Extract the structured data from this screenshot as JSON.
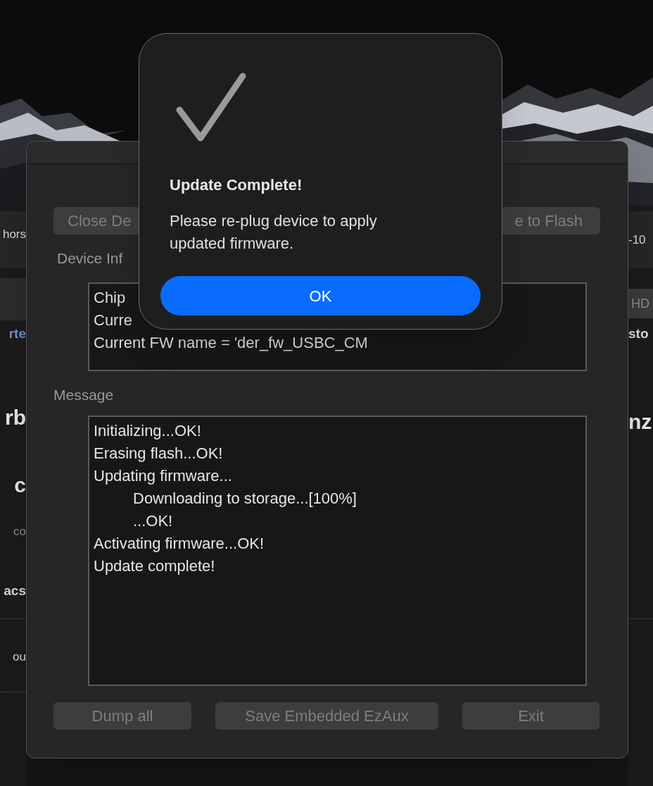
{
  "background_window": {
    "left_fragments": [
      {
        "text": "hors",
        "kind": "plain"
      },
      {
        "text": "rte",
        "kind": "link"
      },
      {
        "text": "rb",
        "kind": "heading"
      },
      {
        "text": "c",
        "kind": "heading"
      },
      {
        "text": "co",
        "kind": "muted"
      },
      {
        "text": "acs",
        "kind": "bold"
      },
      {
        "text": "ou",
        "kind": "plain"
      }
    ],
    "right_fragments": [
      {
        "text": "-10",
        "kind": "plain"
      },
      {
        "text": "HD",
        "kind": "button"
      },
      {
        "text": "sto",
        "kind": "bold"
      },
      {
        "text": "nz",
        "kind": "heading"
      }
    ]
  },
  "dialog": {
    "top_buttons": [
      {
        "label": "Close De",
        "disabled": true
      },
      {
        "label": "e to Flash",
        "disabled": true
      }
    ],
    "device_info": {
      "label": "Device Inf",
      "lines": [
        "Chip",
        "Curre",
        "Current FW name = 'der_fw_USBC_CM"
      ]
    },
    "message": {
      "label": "Message",
      "lines": [
        {
          "text": "Initializing...OK!",
          "indented": false
        },
        {
          "text": "Erasing flash...OK!",
          "indented": false
        },
        {
          "text": "Updating firmware...",
          "indented": false
        },
        {
          "text": "Downloading to storage...[100%]",
          "indented": true
        },
        {
          "text": "...OK!",
          "indented": true
        },
        {
          "text": "Activating firmware...OK!",
          "indented": false
        },
        {
          "text": "Update complete!",
          "indented": false
        }
      ]
    },
    "bottom_buttons": [
      {
        "label": "Dump all",
        "disabled": true
      },
      {
        "label": "Save Embedded EzAux",
        "disabled": true
      },
      {
        "label": "Exit",
        "disabled": true
      }
    ]
  },
  "alert": {
    "title": "Update Complete!",
    "message": "Please re-plug device to apply updated firmware.",
    "button": "OK"
  }
}
